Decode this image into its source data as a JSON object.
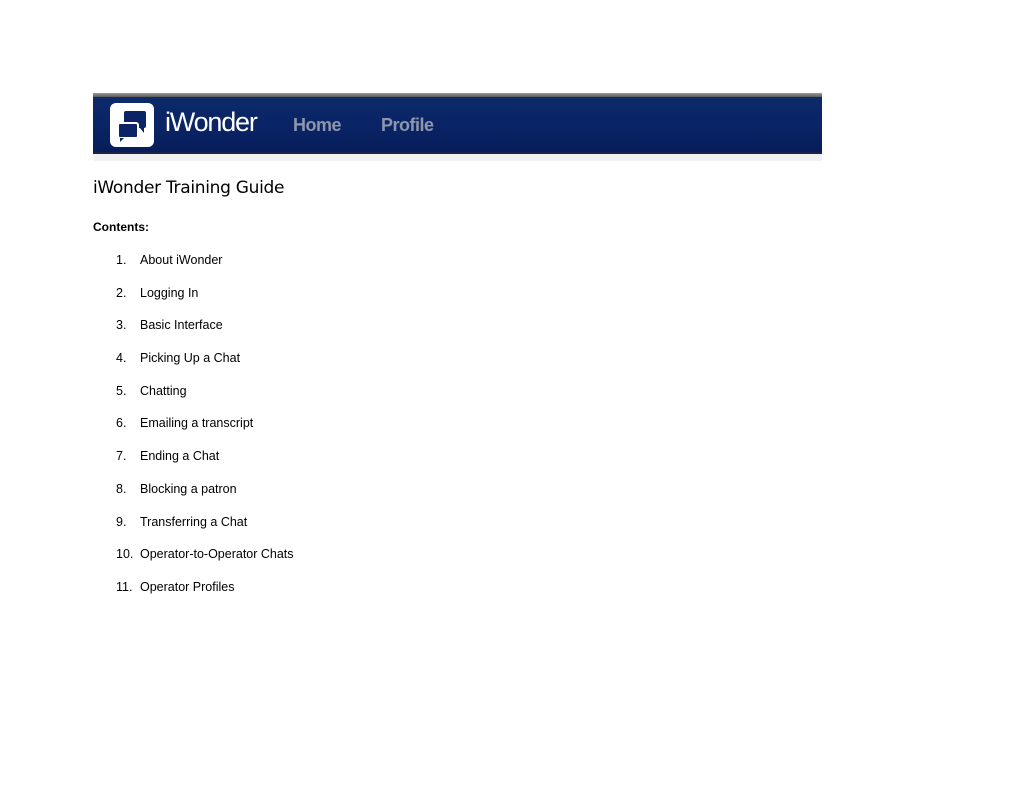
{
  "banner": {
    "brand_name": "iWonder",
    "nav": [
      {
        "label": "Home"
      },
      {
        "label": "Profile"
      }
    ],
    "colors": {
      "bar": "#0a2466",
      "nav_text": "#8d96ad",
      "brand_text": "#ffffff"
    }
  },
  "document": {
    "title": "iWonder Training Guide",
    "contents_label": "Contents:",
    "toc": [
      {
        "num": "1.",
        "label": "About iWonder"
      },
      {
        "num": "2.",
        "label": "Logging In"
      },
      {
        "num": "3.",
        "label": "Basic Interface"
      },
      {
        "num": "4.",
        "label": "Picking Up a Chat"
      },
      {
        "num": "5.",
        "label": "Chatting"
      },
      {
        "num": "6.",
        "label": "Emailing a transcript"
      },
      {
        "num": "7.",
        "label": "Ending a Chat"
      },
      {
        "num": "8.",
        "label": "Blocking a patron"
      },
      {
        "num": "9.",
        "label": "Transferring a Chat"
      },
      {
        "num": "10.",
        "label": "Operator-to-Operator Chats"
      },
      {
        "num": "11.",
        "label": "Operator Profiles"
      }
    ]
  }
}
